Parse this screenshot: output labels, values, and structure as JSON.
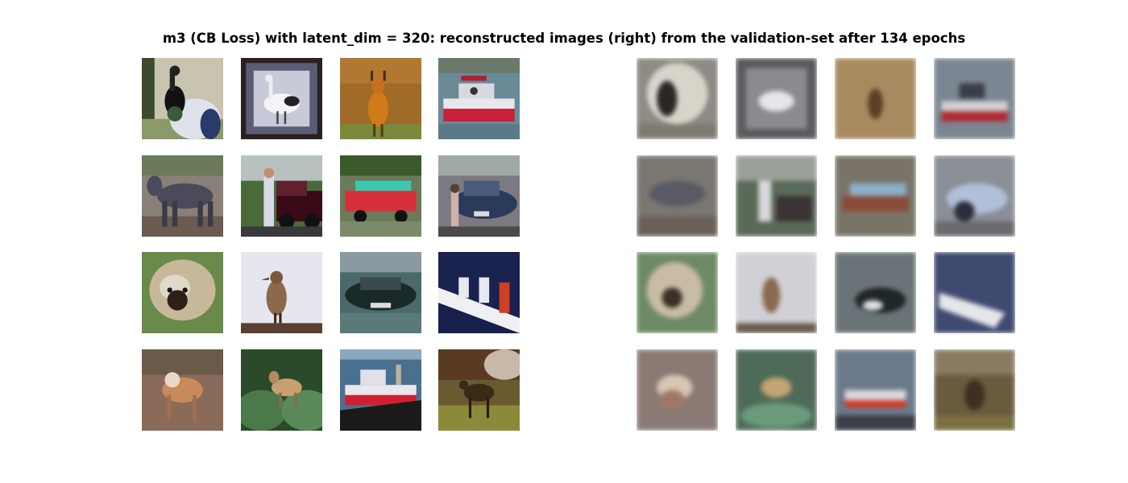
{
  "figure": {
    "title": "m3 (CB Loss) with latent_dim = 320: reconstructed images (right) from the validation-set after 134 epochs"
  },
  "originals": [
    {
      "subject": "black and white bird with a white sphere",
      "bg": "#c4c0b0"
    },
    {
      "subject": "white heron in a frame",
      "bg": "#4b4d63"
    },
    {
      "subject": "deer in orange brush",
      "bg": "#a8762c"
    },
    {
      "subject": "red and white boat on water",
      "bg": "#7a9aa6"
    },
    {
      "subject": "grey horse",
      "bg": "#8f8a86"
    },
    {
      "subject": "person beside red car",
      "bg": "#58704a"
    },
    {
      "subject": "red truck with teal cargo",
      "bg": "#7a8a6a"
    },
    {
      "subject": "dark blue car with person",
      "bg": "#5f6670"
    },
    {
      "subject": "fluffy dog on grass",
      "bg": "#7a8a58"
    },
    {
      "subject": "brown bird standing",
      "bg": "#e2e3ea"
    },
    {
      "subject": "dark green car",
      "bg": "#3e5a5a"
    },
    {
      "subject": "ship on dark blue sea",
      "bg": "#1a2350"
    },
    {
      "subject": "deer on dirt",
      "bg": "#8a6a58"
    },
    {
      "subject": "deer in green bushes",
      "bg": "#2e5a2e"
    },
    {
      "subject": "red and white ship",
      "bg": "#3a6080"
    },
    {
      "subject": "deer on grass field",
      "bg": "#5a4a28"
    }
  ],
  "reconstructions": [
    {
      "subject": "blurred bird",
      "bg": "#8e8a84"
    },
    {
      "subject": "blurred heron",
      "bg": "#76767a"
    },
    {
      "subject": "blurred deer",
      "bg": "#a58a62"
    },
    {
      "subject": "blurred boat",
      "bg": "#7a8490"
    },
    {
      "subject": "blurred horse",
      "bg": "#7a7670"
    },
    {
      "subject": "blurred person and car",
      "bg": "#5a6a5a"
    },
    {
      "subject": "blurred truck",
      "bg": "#7a7468"
    },
    {
      "subject": "blurred car",
      "bg": "#8a8e96"
    },
    {
      "subject": "blurred dog",
      "bg": "#7a8a6a"
    },
    {
      "subject": "blurred bird",
      "bg": "#c8c8ce"
    },
    {
      "subject": "blurred car",
      "bg": "#6a7478"
    },
    {
      "subject": "blurred ship",
      "bg": "#3e4a70"
    },
    {
      "subject": "blurred deer",
      "bg": "#8a7a74"
    },
    {
      "subject": "blurred deer",
      "bg": "#4e6a58"
    },
    {
      "subject": "blurred ship",
      "bg": "#6a7a8a"
    },
    {
      "subject": "blurred deer",
      "bg": "#6a5a3e"
    }
  ]
}
